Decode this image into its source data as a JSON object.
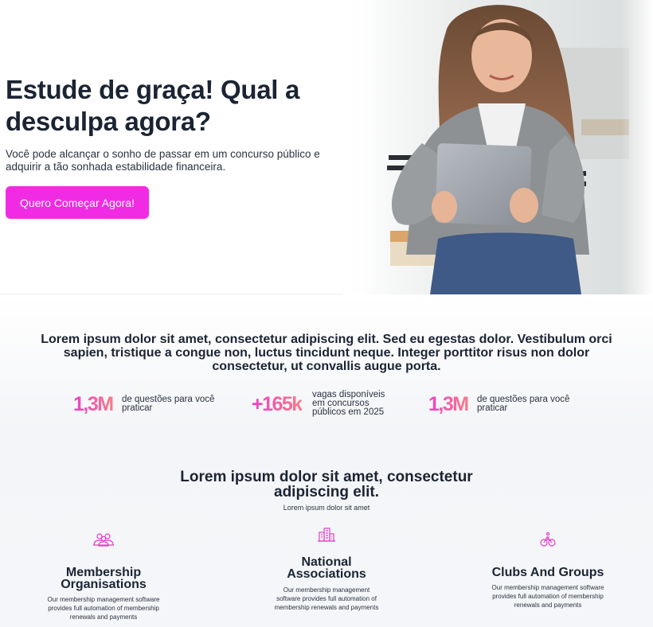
{
  "hero": {
    "title": "Estude de graça! Qual a desculpa agora?",
    "subtitle": "Você pode alcançar o sonho de passar em um concurso público e adquirir a tão sonhada estabilidade financeira.",
    "cta_label": "Quero Começar Agora!",
    "cta_color": "#f12be3"
  },
  "stats": {
    "heading": "Lorem ipsum dolor sit amet, consectetur adipiscing elit. Sed eu egestas dolor. Vestibulum orci sapien, tristique a congue non, luctus tincidunt neque. Integer porttitor risus non dolor consectetur, ut convallis augue porta.",
    "items": [
      {
        "value": "1,3M",
        "label": "de questões para você praticar"
      },
      {
        "value": "+165k",
        "label": "vagas disponíveis em concursos públicos em 2025"
      },
      {
        "value": "1,3M",
        "label": "de questões para você praticar"
      }
    ],
    "number_gradient": [
      "#ee3fc3",
      "#f77c86"
    ]
  },
  "features": {
    "title": "Lorem ipsum dolor sit amet, consectetur adipiscing elit.",
    "subtitle": "Lorem ipsum dolor sit amet",
    "icon_color": "#e23fc8",
    "items": [
      {
        "icon": "group-icon",
        "title": "Membership Organisations",
        "desc": "Our membership management software provides full automation of membership renewals and payments"
      },
      {
        "icon": "buildings-icon",
        "title": "National Associations",
        "desc": "Our membership management software provides full automation of membership renewals and payments"
      },
      {
        "icon": "bicycle-icon",
        "title": "Clubs And Groups",
        "desc": "Our membership management software provides full automation of membership renewals and payments"
      }
    ]
  }
}
